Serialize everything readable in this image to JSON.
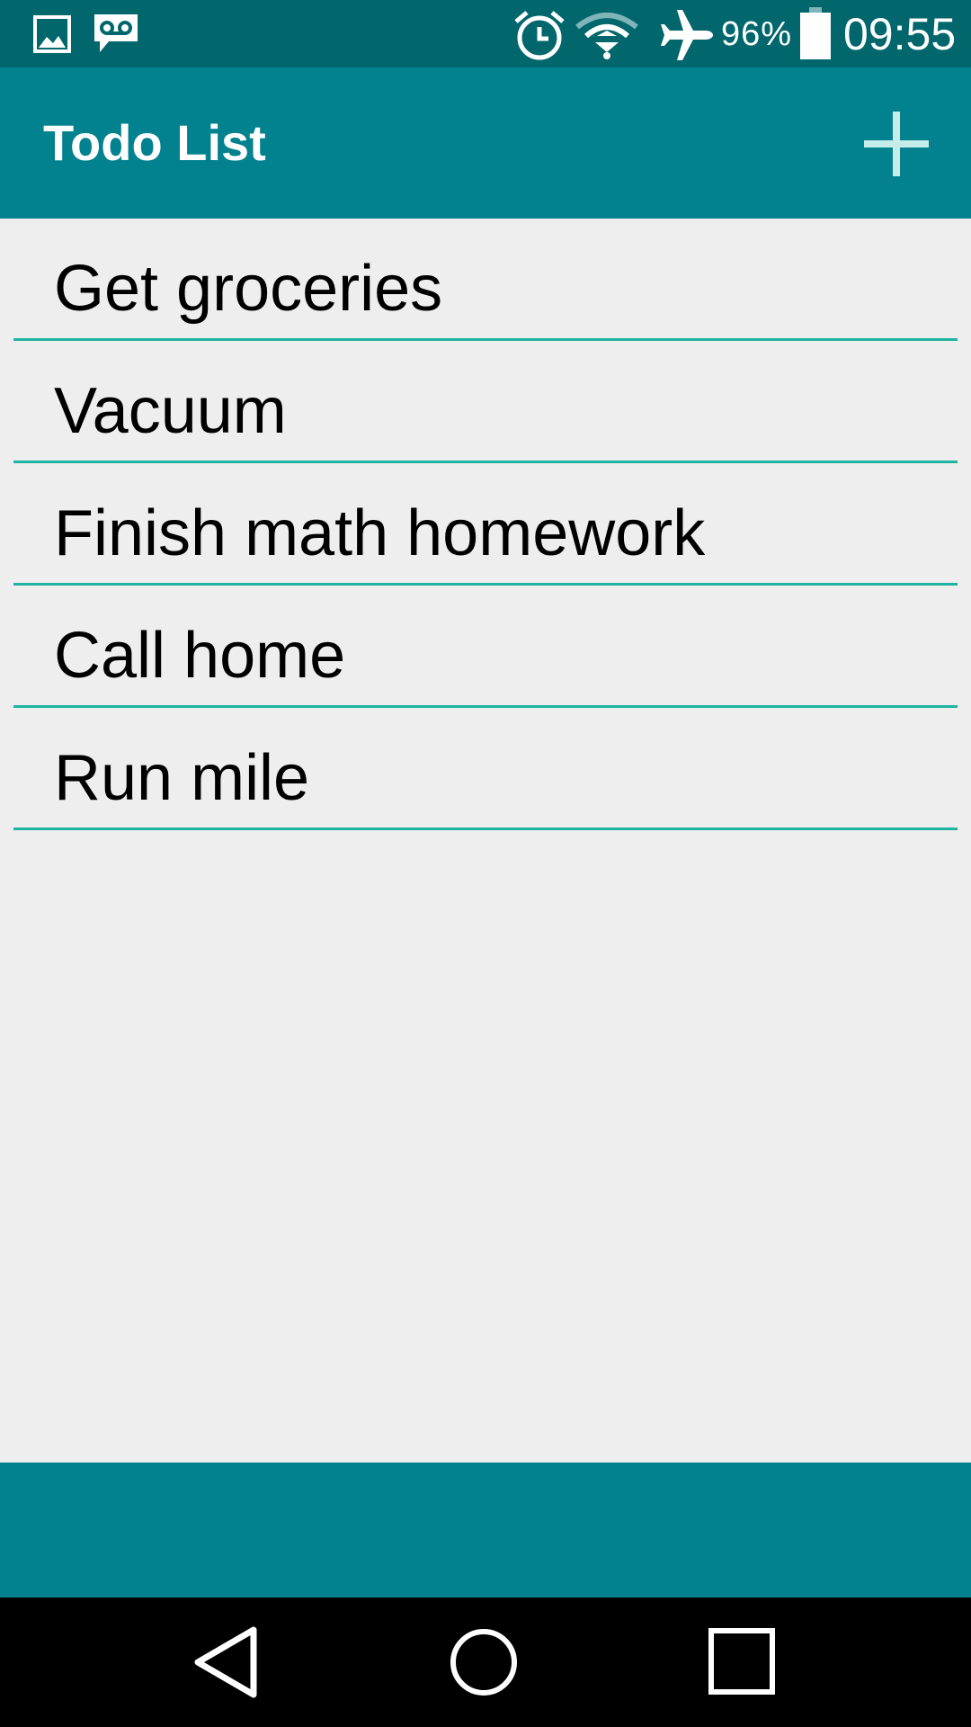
{
  "status_bar": {
    "battery_percent": "96%",
    "time": "09:55",
    "icons": [
      "image-icon",
      "voicemail-icon",
      "alarm-icon",
      "wifi-icon",
      "airplane-icon",
      "battery-icon"
    ]
  },
  "app_bar": {
    "title": "Todo List",
    "add_icon": "plus-icon"
  },
  "todos": [
    {
      "text": "Get groceries"
    },
    {
      "text": "Vacuum"
    },
    {
      "text": "Finish math homework"
    },
    {
      "text": "Call home"
    },
    {
      "text": "Run mile"
    }
  ],
  "nav_bar": {
    "icons": [
      "back-icon",
      "home-icon",
      "recents-icon"
    ]
  },
  "colors": {
    "status_bar": "#02666d",
    "app_bar": "#02828e",
    "divider": "#1fb3a1",
    "background": "#eeeeee"
  }
}
